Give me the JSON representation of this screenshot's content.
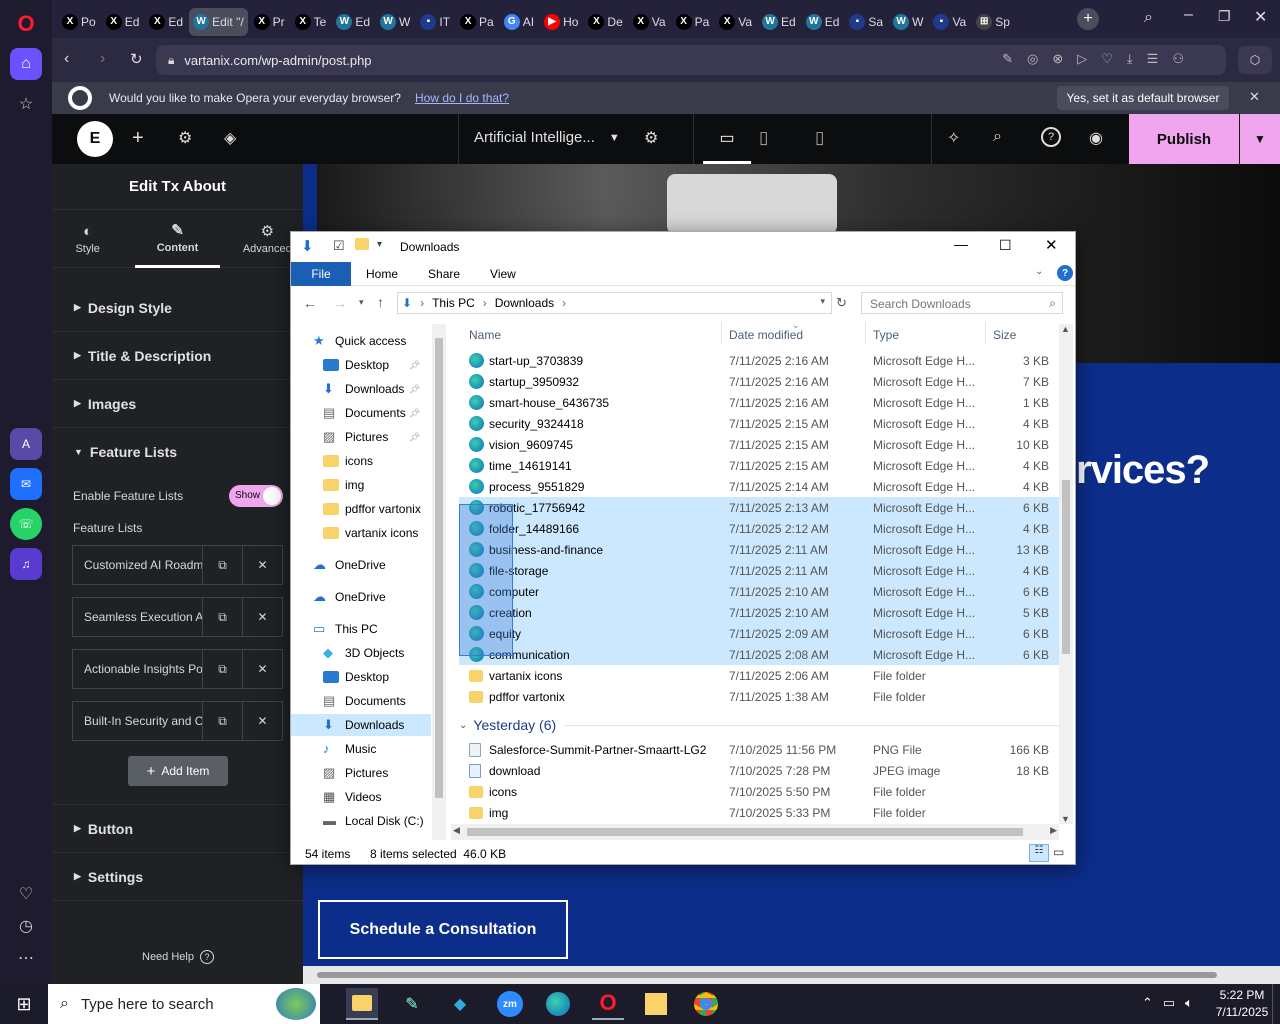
{
  "browser": {
    "tabs": [
      {
        "label": "Po",
        "icon": "x-icon"
      },
      {
        "label": "Ed",
        "icon": "x-icon"
      },
      {
        "label": "Ed",
        "icon": "x-icon"
      },
      {
        "label": "Edit \"/",
        "icon": "wp-icon",
        "active": true
      },
      {
        "label": "Pr",
        "icon": "x-icon"
      },
      {
        "label": "Te",
        "icon": "x-icon"
      },
      {
        "label": "Ed",
        "icon": "wp-icon"
      },
      {
        "label": "W",
        "icon": "wp-icon"
      },
      {
        "label": "IT",
        "icon": "tab-icon"
      },
      {
        "label": "Pa",
        "icon": "x-icon"
      },
      {
        "label": "AI",
        "icon": "google-icon"
      },
      {
        "label": "Ho",
        "icon": "youtube-icon"
      },
      {
        "label": "De",
        "icon": "x-icon"
      },
      {
        "label": "Va",
        "icon": "x-icon"
      },
      {
        "label": "Pa",
        "icon": "x-icon"
      },
      {
        "label": "Va",
        "icon": "x-icon"
      },
      {
        "label": "Ed",
        "icon": "wp-icon"
      },
      {
        "label": "Ed",
        "icon": "wp-icon"
      },
      {
        "label": "Sa",
        "icon": "tab-icon"
      },
      {
        "label": "W",
        "icon": "wp-icon"
      },
      {
        "label": "Va",
        "icon": "tab-icon"
      },
      {
        "label": "Sp",
        "icon": "grid-icon"
      }
    ],
    "url": "vartanix.com/wp-admin/post.php",
    "infobar": {
      "message": "Would you like to make Opera your everyday browser?",
      "link": "How do I do that?",
      "button": "Yes, set it as default browser"
    }
  },
  "elementor": {
    "page_name": "Artificial Intellige...",
    "publish_label": "Publish",
    "panel_title": "Edit Tx About",
    "panel_tabs": [
      {
        "label": "Style",
        "icon": "half-circle-icon"
      },
      {
        "label": "Content",
        "icon": "pencil-icon",
        "active": true
      },
      {
        "label": "Advanced",
        "icon": "gear-icon"
      }
    ],
    "sections": {
      "design_style": "Design Style",
      "title_desc": "Title & Description",
      "images": "Images",
      "feature_lists": "Feature Lists",
      "button": "Button",
      "settings": "Settings"
    },
    "enable_feature_label": "Enable Feature Lists",
    "toggle_label": "Show",
    "feature_lists_label": "Feature Lists",
    "feature_items": [
      "Customized AI Roadm",
      "Seamless Execution A",
      "Actionable Insights Po",
      "Built-In Security and C"
    ],
    "add_item_label": "Add Item",
    "need_help": "Need Help",
    "canvas_heading_fragment": "rvices?",
    "cta_label": "Schedule a Consultation"
  },
  "explorer": {
    "title": "Downloads",
    "ribbon_tabs": [
      "File",
      "Home",
      "Share",
      "View"
    ],
    "breadcrumb": [
      "This PC",
      "Downloads"
    ],
    "search_placeholder": "Search Downloads",
    "columns": [
      "Name",
      "Date modified",
      "Type",
      "Size"
    ],
    "nav_items": [
      {
        "label": "Quick access",
        "icon": "star-icon"
      },
      {
        "label": "Desktop",
        "icon": "desktop-icon",
        "pinned": true
      },
      {
        "label": "Downloads",
        "icon": "download-icon",
        "pinned": true
      },
      {
        "label": "Documents",
        "icon": "documents-icon",
        "pinned": true
      },
      {
        "label": "Pictures",
        "icon": "pictures-icon",
        "pinned": true
      },
      {
        "label": "icons",
        "icon": "folder-icon"
      },
      {
        "label": "img",
        "icon": "folder-icon"
      },
      {
        "label": "pdffor vartonix",
        "icon": "folder-icon"
      },
      {
        "label": "vartanix icons",
        "icon": "folder-icon"
      },
      {
        "label": "OneDrive",
        "icon": "cloud-icon"
      },
      {
        "label": "OneDrive",
        "icon": "cloud-icon"
      },
      {
        "label": "This PC",
        "icon": "pc-icon"
      },
      {
        "label": "3D Objects",
        "icon": "cube-icon"
      },
      {
        "label": "Desktop",
        "icon": "desktop-icon"
      },
      {
        "label": "Documents",
        "icon": "documents-icon"
      },
      {
        "label": "Downloads",
        "icon": "download-icon",
        "selected": true
      },
      {
        "label": "Music",
        "icon": "music-icon"
      },
      {
        "label": "Pictures",
        "icon": "pictures-icon"
      },
      {
        "label": "Videos",
        "icon": "videos-icon"
      },
      {
        "label": "Local Disk (C:)",
        "icon": "disk-icon"
      }
    ],
    "files": [
      {
        "name": "start-up_3703839",
        "date": "7/11/2025 2:16 AM",
        "type": "Microsoft Edge H...",
        "size": "3 KB",
        "kind": "edge"
      },
      {
        "name": "startup_3950932",
        "date": "7/11/2025 2:16 AM",
        "type": "Microsoft Edge H...",
        "size": "7 KB",
        "kind": "edge"
      },
      {
        "name": "smart-house_6436735",
        "date": "7/11/2025 2:16 AM",
        "type": "Microsoft Edge H...",
        "size": "1 KB",
        "kind": "edge"
      },
      {
        "name": "security_9324418",
        "date": "7/11/2025 2:15 AM",
        "type": "Microsoft Edge H...",
        "size": "4 KB",
        "kind": "edge"
      },
      {
        "name": "vision_9609745",
        "date": "7/11/2025 2:15 AM",
        "type": "Microsoft Edge H...",
        "size": "10 KB",
        "kind": "edge"
      },
      {
        "name": "time_14619141",
        "date": "7/11/2025 2:15 AM",
        "type": "Microsoft Edge H...",
        "size": "4 KB",
        "kind": "edge"
      },
      {
        "name": "process_9551829",
        "date": "7/11/2025 2:14 AM",
        "type": "Microsoft Edge H...",
        "size": "4 KB",
        "kind": "edge"
      },
      {
        "name": "robotic_17756942",
        "date": "7/11/2025 2:13 AM",
        "type": "Microsoft Edge H...",
        "size": "6 KB",
        "kind": "edge",
        "selected": true
      },
      {
        "name": "folder_14489166",
        "date": "7/11/2025 2:12 AM",
        "type": "Microsoft Edge H...",
        "size": "4 KB",
        "kind": "edge",
        "selected": true
      },
      {
        "name": "business-and-finance",
        "date": "7/11/2025 2:11 AM",
        "type": "Microsoft Edge H...",
        "size": "13 KB",
        "kind": "edge",
        "selected": true
      },
      {
        "name": "file-storage",
        "date": "7/11/2025 2:11 AM",
        "type": "Microsoft Edge H...",
        "size": "4 KB",
        "kind": "edge",
        "selected": true
      },
      {
        "name": "computer",
        "date": "7/11/2025 2:10 AM",
        "type": "Microsoft Edge H...",
        "size": "6 KB",
        "kind": "edge",
        "selected": true
      },
      {
        "name": "creation",
        "date": "7/11/2025 2:10 AM",
        "type": "Microsoft Edge H...",
        "size": "5 KB",
        "kind": "edge",
        "selected": true
      },
      {
        "name": "equity",
        "date": "7/11/2025 2:09 AM",
        "type": "Microsoft Edge H...",
        "size": "6 KB",
        "kind": "edge",
        "selected": true
      },
      {
        "name": "communication",
        "date": "7/11/2025 2:08 AM",
        "type": "Microsoft Edge H...",
        "size": "6 KB",
        "kind": "edge",
        "selected": true
      },
      {
        "name": "vartanix icons",
        "date": "7/11/2025 2:06 AM",
        "type": "File folder",
        "size": "",
        "kind": "folder"
      },
      {
        "name": "pdffor vartonix",
        "date": "7/11/2025 1:38 AM",
        "type": "File folder",
        "size": "",
        "kind": "folder"
      }
    ],
    "group_yesterday": "Yesterday (6)",
    "files_yesterday": [
      {
        "name": "Salesforce-Summit-Partner-Smaartt-LG2",
        "date": "7/10/2025 11:56 PM",
        "type": "PNG File",
        "size": "166 KB",
        "kind": "png"
      },
      {
        "name": "download",
        "date": "7/10/2025 7:28 PM",
        "type": "JPEG image",
        "size": "18 KB",
        "kind": "jpg"
      },
      {
        "name": "icons",
        "date": "7/10/2025 5:50 PM",
        "type": "File folder",
        "size": "",
        "kind": "folder"
      },
      {
        "name": "img",
        "date": "7/10/2025 5:33 PM",
        "type": "File folder",
        "size": "",
        "kind": "folder"
      }
    ],
    "status_items": "54 items",
    "status_selected": "8 items selected  46.0 KB"
  },
  "taskbar": {
    "search_placeholder": "Type here to search",
    "time": "5:22 PM",
    "date": "7/11/2025"
  },
  "colors": {
    "publish_bg": "#f0a6ee",
    "canvas_blue": "#0c2d8a",
    "selection": "#cce8ff",
    "opera_red": "#ff1b2d"
  }
}
